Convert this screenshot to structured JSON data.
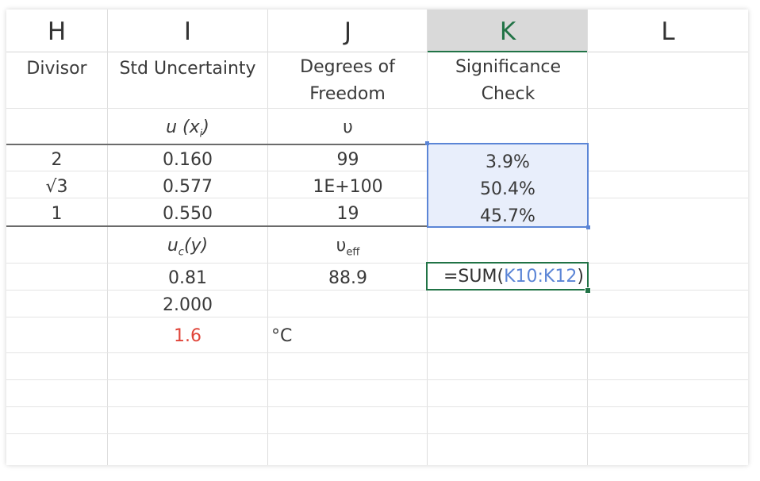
{
  "sheet": {
    "columns": [
      {
        "letter": "H",
        "selected": false
      },
      {
        "letter": "I",
        "selected": false
      },
      {
        "letter": "J",
        "selected": false
      },
      {
        "letter": "K",
        "selected": true
      },
      {
        "letter": "L",
        "selected": false
      }
    ],
    "headers": {
      "divisor": "Divisor",
      "std_uncertainty": "Std Uncertainty",
      "degrees_of_freedom": "Degrees of Freedom",
      "significance_check": "Significance Check"
    },
    "symbols": {
      "u_xi": "u (x",
      "u_xi_sub": "i",
      "u_xi_close": ")",
      "upsilon": "υ",
      "uc_y": "u",
      "uc_sub": "c",
      "uc_y_rest": "(y)",
      "upsilon_eff": "υ",
      "upsilon_eff_sub": "eff"
    },
    "rows": [
      {
        "divisor": "2",
        "std_unc": "0.160",
        "dof": "99",
        "sig": "3.9%"
      },
      {
        "divisor": "√3",
        "std_unc": "0.577",
        "dof": "1E+100",
        "sig": "50.4%"
      },
      {
        "divisor": "1",
        "std_unc": "0.550",
        "dof": "19",
        "sig": "45.7%"
      }
    ],
    "results": {
      "combined_uncertainty": "0.81",
      "effective_dof": "88.9",
      "coverage_factor": "2.000",
      "expanded_uncertainty": "1.6",
      "unit": "°C"
    },
    "formula": {
      "prefix": "=SUM(",
      "range": "K10:K12",
      "suffix": ")"
    },
    "colors": {
      "accent_green": "#217346",
      "selection_blue": "#5b85d6",
      "highlight_red": "#e0453a"
    }
  }
}
